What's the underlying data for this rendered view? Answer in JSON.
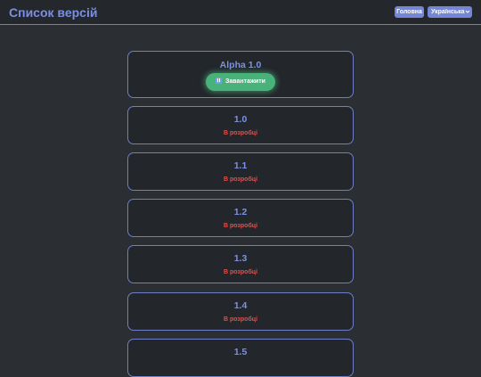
{
  "header": {
    "title": "Список версій",
    "home_label": "Головна",
    "language_selected": "Українська"
  },
  "versions": [
    {
      "name": "Alpha 1.0",
      "download_label": "Завантажити"
    },
    {
      "name": "1.0",
      "status": "В розробці"
    },
    {
      "name": "1.1",
      "status": "В розробці"
    },
    {
      "name": "1.2",
      "status": "В розробці"
    },
    {
      "name": "1.3",
      "status": "В розробці"
    },
    {
      "name": "1.4",
      "status": "В розробці"
    },
    {
      "name": "1.5"
    }
  ],
  "colors": {
    "background": "#2b2e33",
    "accent": "#7386d8",
    "status_red": "#e0514b",
    "download_green": "#48b27a"
  }
}
